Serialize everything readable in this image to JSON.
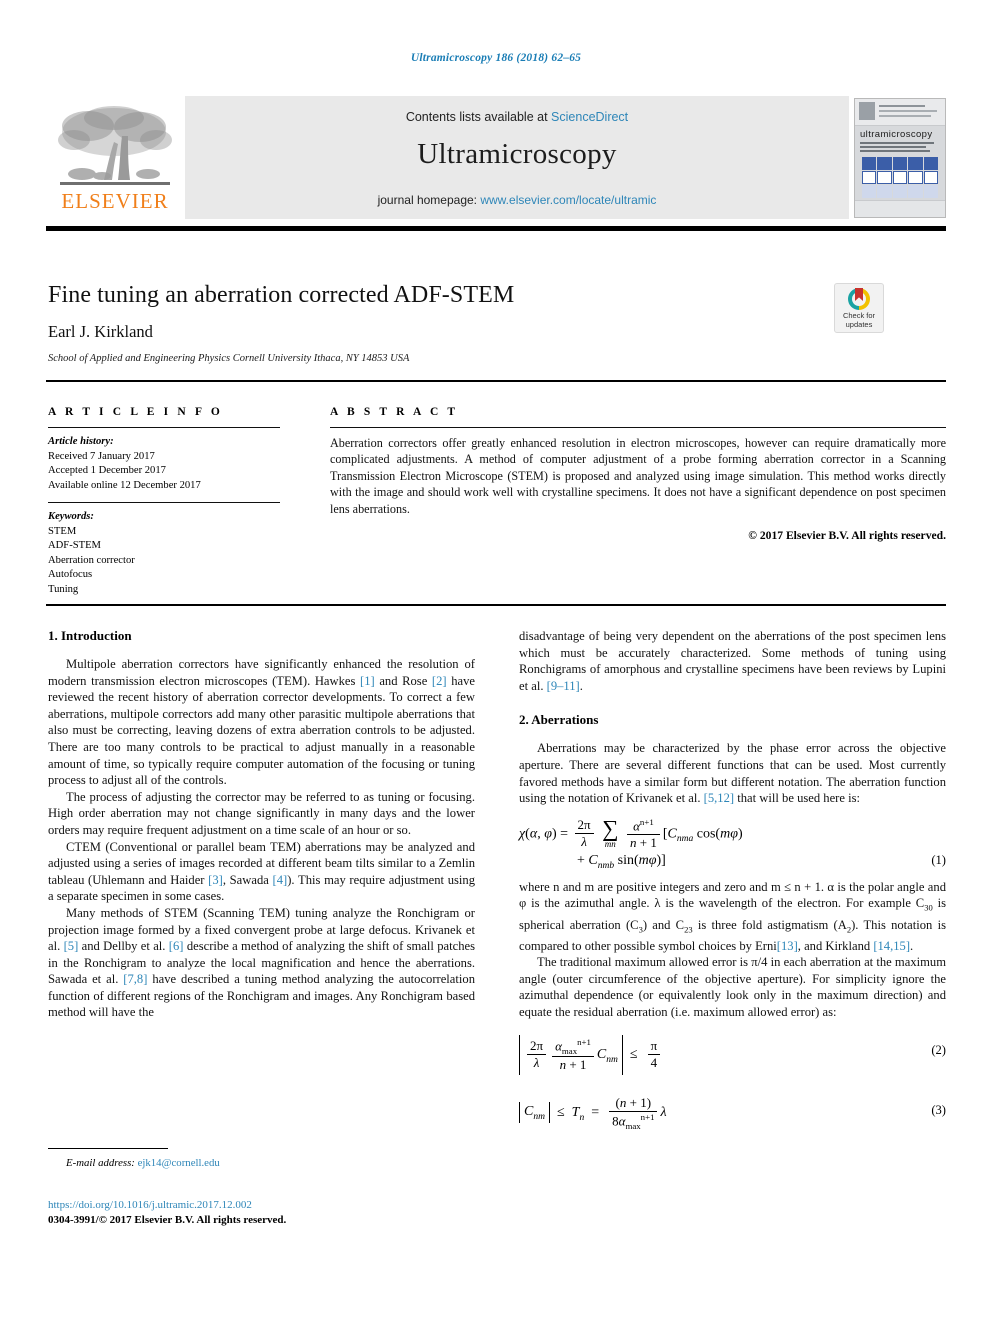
{
  "running_head": "Ultramicroscopy 186 (2018) 62–65",
  "masthead": {
    "contents_prefix": "Contents lists available at",
    "contents_link": "ScienceDirect",
    "journal_title": "Ultramicroscopy",
    "homepage_prefix": "journal homepage:",
    "homepage_link": "www.elsevier.com/locate/ultramic",
    "publisher_wordmark": "ELSEVIER",
    "cover_title": "ultramicroscopy"
  },
  "article": {
    "title": "Fine tuning an aberration corrected ADF-STEM",
    "author": "Earl J. Kirkland",
    "affiliation": "School of Applied and Engineering Physics Cornell University Ithaca, NY 14853 USA",
    "crossmark": {
      "line1": "Check for",
      "line2": "updates"
    }
  },
  "article_info": {
    "heading": "A R T I C L E   I N F O",
    "history_label": "Article history:",
    "history": [
      "Received 7 January 2017",
      "Accepted 1 December 2017",
      "Available online 12 December 2017"
    ],
    "keywords_label": "Keywords:",
    "keywords": [
      "STEM",
      "ADF-STEM",
      "Aberration corrector",
      "Autofocus",
      "Tuning"
    ]
  },
  "abstract": {
    "heading": "A B S T R A C T",
    "text": "Aberration correctors offer greatly enhanced resolution in electron microscopes, however can require dramatically more complicated adjustments. A method of computer adjustment of a probe forming aberration corrector in a Scanning Transmission Electron Microscope (STEM) is proposed and analyzed using image simulation. This method works directly with the image and should work well with crystalline specimens. It does not have a significant dependence on post specimen lens aberrations.",
    "copyright": "© 2017 Elsevier B.V. All rights reserved."
  },
  "sections": {
    "introduction_heading": "1. Introduction",
    "aberrations_heading": "2. Aberrations"
  },
  "left_column": {
    "p1_a": "Multipole aberration correctors have significantly enhanced the resolution of modern transmission electron microscopes (TEM). Hawkes ",
    "p1_ref1": "[1]",
    "p1_b": " and Rose ",
    "p1_ref2": "[2]",
    "p1_c": " have reviewed the recent history of aberration corrector developments. To correct a few aberrations, multipole correctors add many other parasitic multipole aberrations that also must be correcting, leaving dozens of extra aberration controls to be adjusted. There are too many controls to be practical to adjust manually in a reasonable amount of time, so typically require computer automation of the focusing or tuning process to adjust all of the controls.",
    "p2": "The process of adjusting the corrector may be referred to as tuning or focusing. High order aberration may not change significantly in many days and the lower orders may require frequent adjustment on a time scale of an hour or so.",
    "p3_a": "CTEM (Conventional or parallel beam TEM) aberrations may be analyzed and adjusted using a series of images recorded at different beam tilts similar to a Zemlin tableau (Uhlemann and Haider ",
    "p3_ref1": "[3]",
    "p3_b": ", Sawada ",
    "p3_ref2": "[4]",
    "p3_c": "). This may require adjustment using a separate specimen in some cases.",
    "p4_a": "Many methods of STEM (Scanning TEM) tuning analyze the Ronchigram or projection image formed by a fixed convergent probe at large defocus. Krivanek et al. ",
    "p4_ref1": "[5]",
    "p4_b": " and Dellby et al. ",
    "p4_ref2": "[6]",
    "p4_c": " describe a method of analyzing the shift of small patches in the Ronchigram to analyze the local magnification and hence the aberrations. Sawada et al. ",
    "p4_ref3": "[7,8]",
    "p4_d": " have described a tuning method analyzing the autocorrelation function of different regions of the Ronchigram and images. Any Ronchigram based method will have the"
  },
  "right_column": {
    "p1_a": "disadvantage of being very dependent on the aberrations of the post specimen lens which must be accurately characterized. Some methods of tuning using Ronchigrams of amorphous and crystalline specimens have been reviews by Lupini et al. ",
    "p1_ref1": "[9–11]",
    "p1_b": ".",
    "p2_a": "Aberrations may be characterized by the phase error across the objective aperture. There are several different functions that can be used. Most currently favored methods have a similar form but different notation. The aberration function using the notation of Krivanek et al. ",
    "p2_ref1": "[5,12]",
    "p2_b": " that will be used here is:",
    "p3_a": "where n and m are positive integers and zero and m ≤ n + 1. α is the polar angle and φ is the azimuthal angle. λ is the wavelength of the electron. For example C",
    "p3_sub1": "30",
    "p3_b": " is spherical aberration (C",
    "p3_sub2": "3",
    "p3_c": ") and C",
    "p3_sub3": "23",
    "p3_d": " is three fold astigmatism (A",
    "p3_sub4": "2",
    "p3_e": "). This notation is compared to other possible symbol choices by Erni",
    "p3_ref1": "[13]",
    "p3_f": ", and Kirkland ",
    "p3_ref2": "[14,15]",
    "p3_g": ".",
    "p4": "The traditional maximum allowed error is π/4 in each aberration at the maximum angle (outer circumference of the objective aperture). For simplicity ignore the azimuthal dependence (or equivalently look only in the maximum direction) and equate the residual aberration (i.e. maximum allowed error) as:"
  },
  "equations": {
    "eq1_number": "(1)",
    "eq2_number": "(2)",
    "eq3_number": "(3)"
  },
  "footer": {
    "email_label": "E-mail address:",
    "email": "ejk14@cornell.edu",
    "doi": "https://doi.org/10.1016/j.ultramic.2017.12.002",
    "issn_line": "0304-3991/© 2017 Elsevier B.V. All rights reserved."
  },
  "colors": {
    "link": "#2e86b8",
    "running_head": "#1a7db5",
    "elsevier_orange": "#f07f1a"
  }
}
